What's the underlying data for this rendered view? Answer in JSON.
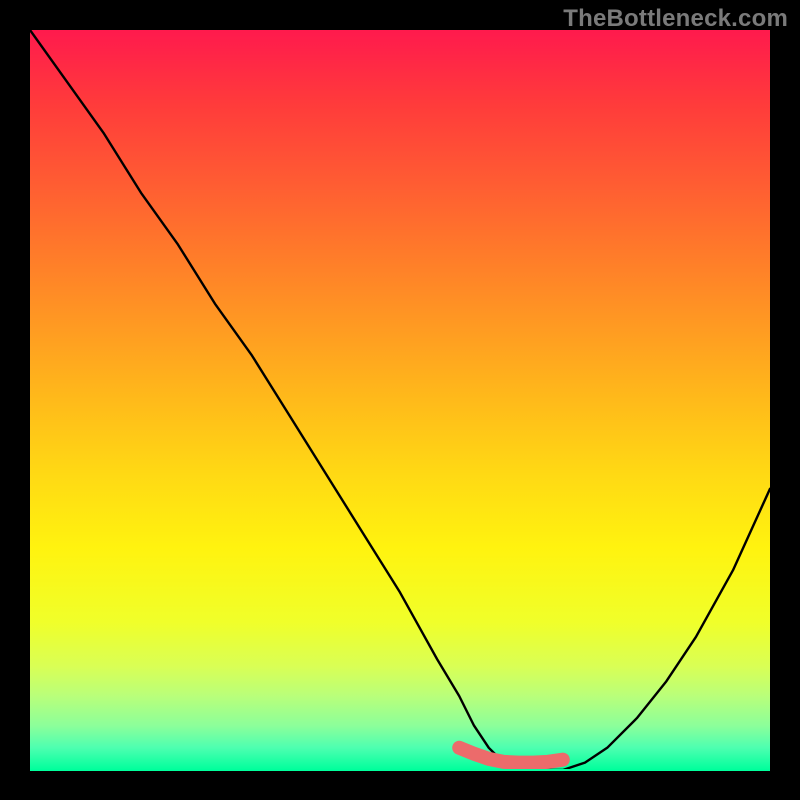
{
  "attribution": "TheBottleneck.com",
  "chart_data": {
    "type": "line",
    "title": "",
    "xlabel": "",
    "ylabel": "",
    "xlim": [
      0,
      100
    ],
    "ylim": [
      0,
      100
    ],
    "x": [
      0,
      5,
      10,
      15,
      20,
      25,
      30,
      35,
      40,
      45,
      50,
      55,
      58,
      60,
      62,
      64,
      66,
      68,
      70,
      72,
      75,
      78,
      82,
      86,
      90,
      95,
      100
    ],
    "values": [
      100,
      93,
      86,
      78,
      71,
      63,
      56,
      48,
      40,
      32,
      24,
      15,
      10,
      6,
      3,
      1,
      0,
      0,
      0,
      0,
      1,
      3,
      7,
      12,
      18,
      27,
      38
    ],
    "highlight_segment": {
      "x": [
        58,
        60,
        62,
        64,
        66,
        68,
        70,
        72
      ],
      "values": [
        3,
        2.2,
        1.5,
        1.1,
        1.0,
        1.0,
        1.1,
        1.4
      ],
      "color": "#ec6b6b"
    },
    "background_gradient": {
      "top": "#ff1a4d",
      "middle": "#ffd914",
      "bottom": "#00ff9c"
    }
  }
}
